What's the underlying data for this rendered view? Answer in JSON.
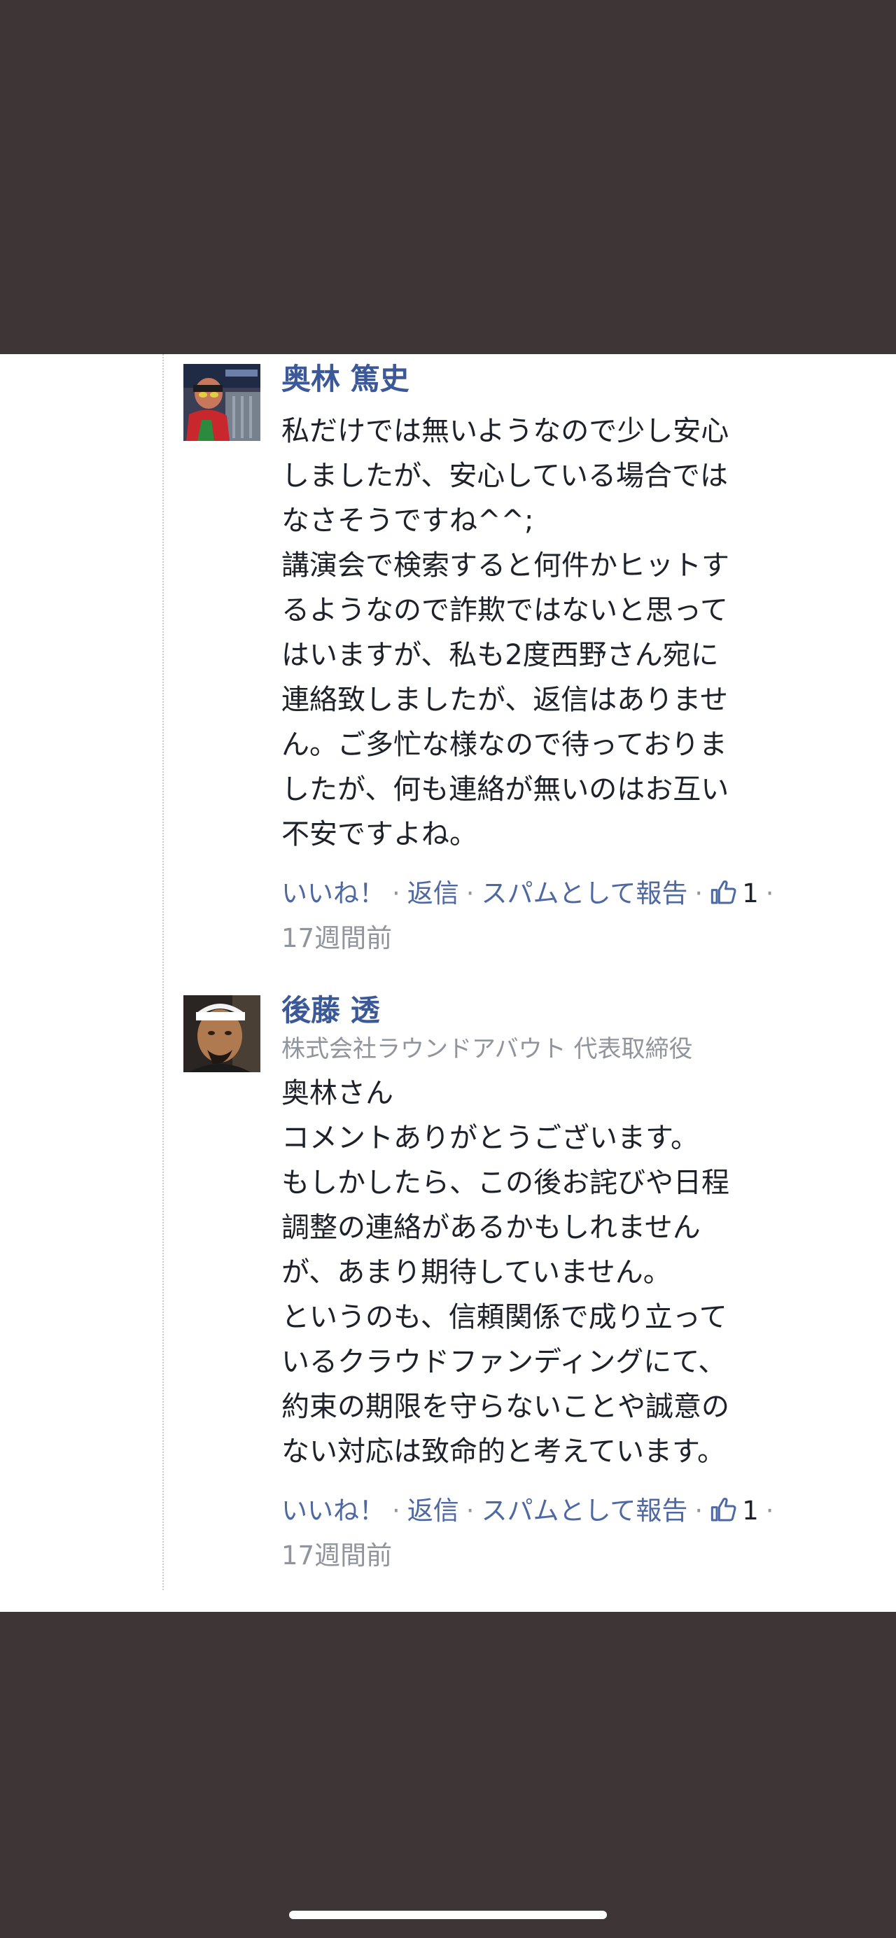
{
  "comments": [
    {
      "author": "奥林 篤史",
      "subtitle": "",
      "lines": [
        "私だけでは無いようなので少し安心",
        "しましたが、安心している場合では",
        "なさそうですね^^;",
        "講演会で検索すると何件かヒットす",
        "るようなので詐欺ではないと思って",
        "はいますが、私も2度西野さん宛に",
        "連絡致しましたが、返信はありませ",
        "ん。ご多忙な様なので待っておりま",
        "したが、何も連絡が無いのはお互い",
        "不安ですよね。"
      ],
      "actions": {
        "like": "いいね！",
        "reply": "返信",
        "report": "スパムとして報告",
        "like_count": "1",
        "time": "17週間前"
      },
      "avatar_icon": "avatar-photo-icon"
    },
    {
      "author": "後藤 透",
      "subtitle": "株式会社ラウンドアバウト 代表取締役",
      "lines": [
        "奥林さん",
        "コメントありがとうございます。",
        "もしかしたら、この後お詫びや日程",
        "調整の連絡があるかもしれません",
        "が、あまり期待していません。",
        "というのも、信頼関係で成り立って",
        "いるクラウドファンディングにて、",
        "約束の期限を守らないことや誠意の",
        "ない対応は致命的と考えています。"
      ],
      "actions": {
        "like": "いいね！",
        "reply": "返信",
        "report": "スパムとして報告",
        "like_count": "1",
        "time": "17週間前"
      },
      "avatar_icon": "avatar-photo-icon"
    }
  ],
  "colors": {
    "background": "#3e3536",
    "panel": "#ffffff",
    "link": "#4e69a2",
    "name": "#3b5998",
    "meta": "#90949c",
    "text": "#1d2129"
  },
  "icons": {
    "like": "thumbs-up-icon",
    "thread": "thread-line"
  }
}
